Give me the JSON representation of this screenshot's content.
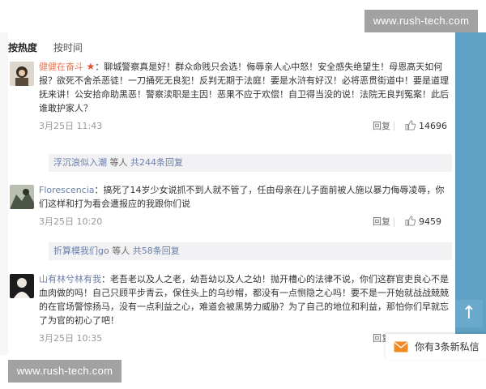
{
  "sort_tabs": [
    "按热度",
    "按时间"
  ],
  "comments": [
    {
      "username": "健健在奋斗",
      "badge": "★",
      "text": "：聊城警察真是好！群众命贱只会选！侮辱亲人心中怒！安全感失绝望生！母恩高天如何报？欲死不舍杀恶徒！一刀捅死无良犯！反判无期于法庭！要是水浒有好汉！必将恶贯街道中！要是道理抚来讲！公安拾命助黑恶！警察渎职是主因！恶果不应于欢偿！自卫得当没的说！法院无良判冤案！此后谁敢护家人？",
      "time": "3月25日 11:43",
      "reply_label": "回复",
      "likes": "14696",
      "sub_reply": {
        "name": "浮沉浪似入潮",
        "middle": " 等人 ",
        "count": "共244条回复"
      }
    },
    {
      "username": "Florescencia",
      "badge": "",
      "text": "：搞死了14岁少女说抓不到人就不管了，任由母亲在儿子面前被人施以暴力侮辱凌辱，你们这样和打为看会遭报应的我跟你们说",
      "time": "3月25日 10:20",
      "reply_label": "回复",
      "likes": "9459",
      "sub_reply": {
        "name": "折算模我们go",
        "middle": " 等人 ",
        "count": "共58条回复"
      }
    },
    {
      "username": "山有林兮林有我",
      "badge": "",
      "text": "：老吾老以及人之老，幼吾幼以及人之幼！抛开槽心的法律不说，你们这群官吏良心不是血肉做的吗！自己只顾平步青云，保住头上的乌纱帽，都没有一点恻隐之心吗！要不是一开始就战战兢兢的在官场警惊扬马，没有一点利益之心，难道会被黑势力威胁？为了自己的地位和利益，那怕你们早就忘了为官的初心了吧！",
      "time": "3月25日 10:35",
      "reply_label": "回复",
      "likes": "",
      "sub_reply": null
    }
  ],
  "scroll_top_label": "↑",
  "notification": "你有3条新私信",
  "watermark_text": "www.rush-tech.com",
  "colors": {
    "username": "#eb7350",
    "link": "#6a7fa8",
    "scrollbar": "#5ea1c4"
  }
}
